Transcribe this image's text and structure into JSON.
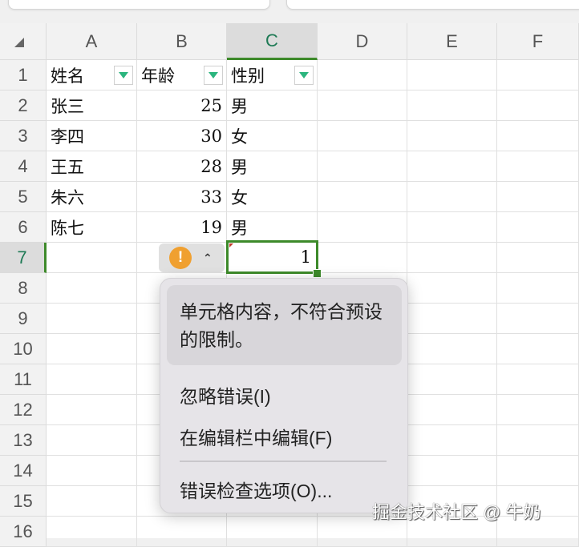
{
  "columns": [
    "A",
    "B",
    "C",
    "D",
    "E",
    "F"
  ],
  "selected_column": "C",
  "rows": [
    [
      "姓名",
      "年龄",
      "性别"
    ],
    [
      "张三",
      "25",
      "男"
    ],
    [
      "李四",
      "30",
      "女"
    ],
    [
      "王五",
      "28",
      "男"
    ],
    [
      "朱六",
      "33",
      "女"
    ],
    [
      "陈七",
      "19",
      "男"
    ],
    [
      "",
      "",
      "1"
    ]
  ],
  "row_numbers": [
    "1",
    "2",
    "3",
    "4",
    "5",
    "6",
    "7",
    "8",
    "9",
    "10",
    "11",
    "12",
    "13",
    "14",
    "15",
    "16"
  ],
  "selected_row": "7",
  "error_button": {
    "icon": "warning-icon",
    "warn_glyph": "!",
    "caret": "⌃"
  },
  "popup": {
    "message": "单元格内容，不符合预设的限制。",
    "items": [
      "忽略错误(I)",
      "在编辑栏中编辑(F)",
      "错误检查选项(O)..."
    ]
  },
  "watermark": "掘金技术社区 @ 牛奶"
}
